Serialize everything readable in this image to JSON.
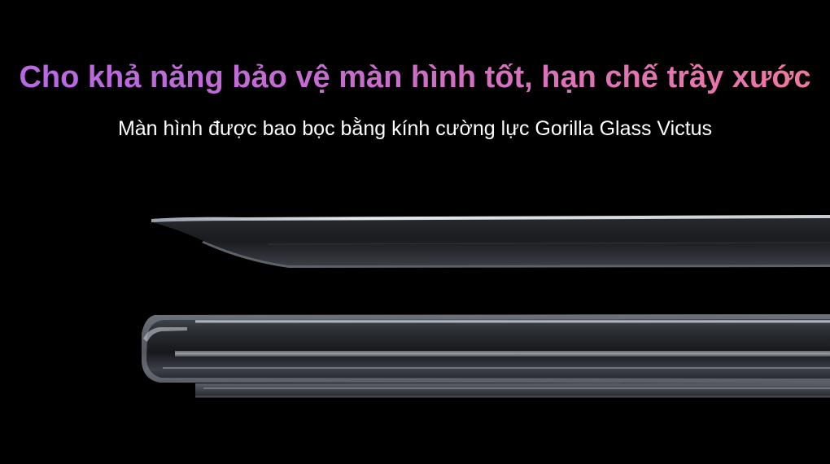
{
  "headline": {
    "text": "Cho khả năng bảo vệ màn hình tốt, hạn chế trầy xước",
    "gradient_colors": [
      "#b668e4",
      "#ee789f"
    ]
  },
  "subheadline": {
    "text": "Màn hình được bao bọc bằng kính cường lực Gorilla Glass Victus",
    "color": "#ffffff"
  },
  "background_color": "#000000",
  "illustration": {
    "subject": "glass-panel-above-phone-edge"
  }
}
